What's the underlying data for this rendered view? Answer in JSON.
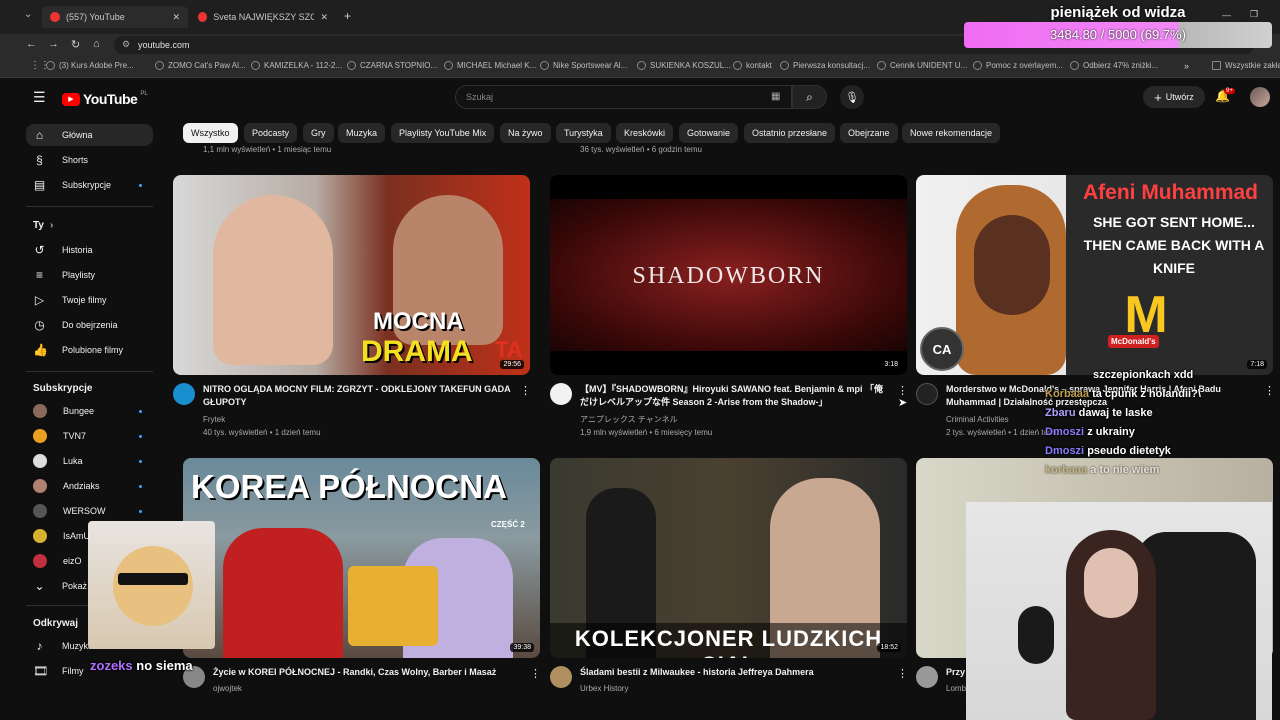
{
  "browser": {
    "tabs": [
      {
        "label": "(557) YouTube"
      },
      {
        "label": "Sveta NAJWIĘKSZY SZON z Ro..."
      }
    ],
    "url": "youtube.com",
    "bookmarks": [
      "(3) Kurs Adobe Pre...",
      "ZOMO Cat's Paw Al...",
      "KAMIZELKA - 112-2...",
      "CZARNA STOPNIO...",
      "MICHAEL Michael K...",
      "Nike Sportswear Al...",
      "SUKIENKA KOSZUL...",
      "kontakt",
      "Pierwsza konsultacj...",
      "Cennik UNIDENT U...",
      "Pomoc z overlayem...",
      "Odbierz 47% zniżki...",
      "Wszystkie zakładki"
    ]
  },
  "overlay": {
    "donation_title": "pieniążek od widza",
    "donation_text": "3484.80 / 5000 (69.7%)",
    "donation_progress": 0.697,
    "chat": [
      {
        "user": "",
        "msg": "szczepionkach xdd"
      },
      {
        "user": "Korbaaa",
        "msg": "ta cpunk z holandii?\\"
      },
      {
        "user": "Zbaru",
        "msg": "dawaj te laske"
      },
      {
        "user": "Dmoszi",
        "msg": "z ukrainy"
      },
      {
        "user": "Dmoszi",
        "msg": "pseudo dietetyk"
      },
      {
        "user": "korbaaa",
        "msg": "a to nie wiem"
      }
    ],
    "cat_chat_user": "zozeks",
    "cat_chat_msg": "no siema"
  },
  "youtube": {
    "logo": "YouTube",
    "region": "PL",
    "search_placeholder": "Szukaj",
    "create_label": "Utwórz",
    "notif_count": "9+",
    "chips": [
      "Wszystko",
      "Podcasty",
      "Gry",
      "Muzyka",
      "Playlisty YouTube Mix",
      "Na żywo",
      "Turystyka",
      "Kreskówki",
      "Gotowanie",
      "Ostatnio przesłane",
      "Obejrzane",
      "Nowe rekomendacje"
    ],
    "sidebar": {
      "main": [
        {
          "label": "Główna",
          "icon": "home-icon"
        },
        {
          "label": "Shorts",
          "icon": "shorts-icon"
        },
        {
          "label": "Subskrypcje",
          "icon": "subscriptions-icon"
        }
      ],
      "you_header": "Ty",
      "you": [
        {
          "label": "Historia",
          "icon": "history-icon"
        },
        {
          "label": "Playlisty",
          "icon": "playlist-icon"
        },
        {
          "label": "Twoje filmy",
          "icon": "video-icon"
        },
        {
          "label": "Do obejrzenia",
          "icon": "clock-icon"
        },
        {
          "label": "Polubione filmy",
          "icon": "like-icon"
        }
      ],
      "subs_header": "Subskrypcje",
      "subs": [
        {
          "label": "Bungee",
          "color": "#8a6a5a"
        },
        {
          "label": "TVN7",
          "color": "#e8a020"
        },
        {
          "label": "Luka",
          "color": "#ddd"
        },
        {
          "label": "Andziaks",
          "color": "#b08070"
        },
        {
          "label": "WERSOW",
          "color": "#555"
        },
        {
          "label": "IsAmU",
          "color": "#d8b030"
        },
        {
          "label": "eizO",
          "color": "#c03040"
        }
      ],
      "show_more": "Pokaż",
      "explore_header": "Odkrywaj",
      "explore": [
        {
          "label": "Muzyka",
          "icon": "music-icon"
        },
        {
          "label": "Filmy",
          "icon": "film-icon"
        }
      ]
    },
    "videos": [
      {
        "title": "NITRO OGLĄDA MOCNY FILM: ZGRZYT - ODKLEJONY TAKEFUN GADA GŁUPOTY",
        "channel": "Frytek",
        "meta": "40 tys. wyświetleń • 1 dzień temu",
        "duration": "29:56",
        "thumb_text": "MOCNA",
        "thumb_text2": "DRAMA",
        "thumb_text3": "TA"
      },
      {
        "title": "【MV】『SHADOWBORN』Hiroyuki SAWANO feat. Benjamin & mpi 「俺だけレベルアップな件 Season 2 -Arise from the Shadow-」",
        "channel": "アニプレックス チャンネル",
        "meta": "1,9 mln wyświetleń • 6 miesięcy temu",
        "duration": "3:18",
        "thumb_text": "SHADOWBORN"
      },
      {
        "title": "Morderstwo w McDonald's – sprawa Jennifer Harris | Afeni Badu Muhammad | Działalność przestępcza",
        "channel": "Criminal Activities",
        "meta": "2 tys. wyświetleń • 1 dzień temu",
        "duration": "7:18",
        "thumb_text": "Afeni Muhammad",
        "thumb_text2": "SHE GOT SENT HOME... THEN CAME BACK WITH A KNIFE",
        "thumb_logo": "CA",
        "thumb_brand": "McDonald's"
      },
      {
        "title": "Życie w KOREI PÓŁNOCNEJ - Randki, Czas Wolny, Barber i Masaż",
        "channel": "ojwojtek",
        "meta": "",
        "duration": "39:38",
        "thumb_text": "KOREA PÓŁNOCNA",
        "thumb_text2": "CZĘŚĆ 2"
      },
      {
        "title": "Śladami bestii z Milwaukee - historia Jeffreya Dahmera",
        "channel": "Urbex History",
        "meta": "",
        "duration": "18:52",
        "thumb_text": "KOLEKCJONER LUDZKICH CIAŁ"
      },
      {
        "title": "Przy",
        "channel": "Lomb",
        "meta": "",
        "duration": ""
      }
    ],
    "prev_meta": [
      "1,1 mln wyświetleń • 1 miesiąc temu",
      "36 tys. wyświetleń • 6 godzin temu"
    ]
  }
}
